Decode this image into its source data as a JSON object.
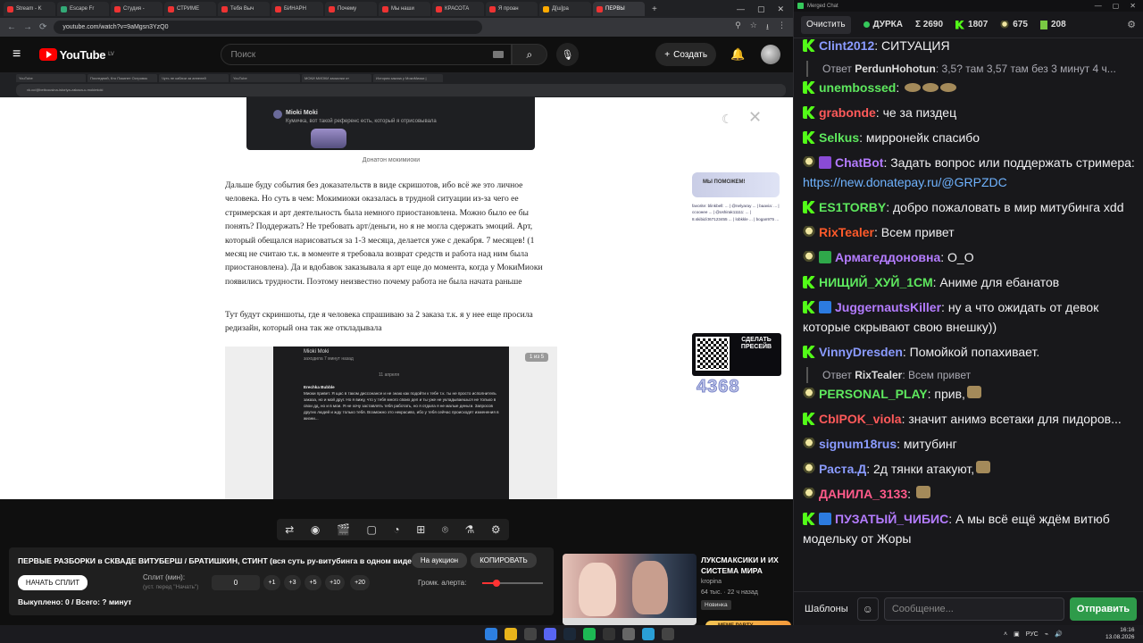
{
  "browser": {
    "tabs": [
      "Stream - K",
      "Escape Fr",
      "Студия -",
      "СТРИМЕ",
      "Тебя Выч",
      "БИНАРН",
      "Почему",
      "Мы наши",
      "КРАСОТА",
      "Я проан",
      "Д[ш]ра",
      "ПЕРВЫ"
    ],
    "url": "youtube.com/watch?v=9aMgsn3YzQ0"
  },
  "youtube": {
    "logo": "YouTube",
    "region": "LV",
    "search_placeholder": "Поиск",
    "create_label": "Создать"
  },
  "inner_browser": {
    "tabs": [
      "YouTube",
      "Последний, Кто Покинет Островок",
      "Чуть не кабачи за аппелей",
      "YouTube",
      "МОКИ МИОКИ заскалки от",
      "История заказа у МокиМиоки |"
    ],
    "url": "vk.cc/@bettcousina-istoriya-zakaza-u-mokimioki"
  },
  "article": {
    "image_user": "Mioki Moki",
    "image_subtitle": "Кумичка, вот такой референс есть, который я отрисовывала",
    "image_caption": "Донатон мокимиоки",
    "paragraph1": "Дальше буду события без доказательств в виде скришотов, ибо всё же это личное человека. Но суть в чем: Мокимиоки оказалась в трудной ситуации из-за чего ее стримерская и арт деятельность была немного приостановлена. Можно было ее бы понять? Поддержать? Не требовать арт/деньги, но я не могла сдержать эмоций. Арт, который обещался нарисоваться за 1-3 месяца, делается уже с декабря. 7 месяцев! (1 месяц не считаю т.к. в моменте я требовала возврат средств и работа над ним была приостановлена). Да и вдобавок заказывала я арт еще до момента, когда у МокиМиоки появились трудности. Поэтому неизвестно почему работа не была начата раньше",
    "paragraph2": "Тут будут скриншоты, где я человека спрашиваю за 2 заказа т.к. я у нее еще просила редизайн, который она так же откладывала",
    "screenshot_header": "Mioki Moki",
    "screenshot_sub": "заходила 7 минут назад",
    "screenshot_date": "11 апреля",
    "screenshot_sender": "Erechka Bubble",
    "screenshot_body": "Миоки привет. Я щас в таком диссонансе и не знаю как подойти к тебе т.к. ты не просто исполнитель заказа, но и мой друг. Но я вижу, что у тебя много своих дел и ты уже не укладываешься не только в свои дд, но и в мои. Я не хочу заставлять тебя работать, но я отдала я не малые деньги. Запросов других людей и жду только тебя. Возможно это некрасиво, ибо у тебя сейчас происходят изменения в жизни...",
    "screenshot_counter": "1 из 5",
    "ad_banner": "МЫ ПОМОЖЕМ!",
    "ad_list": "favorite: blinkbell: ... | @nelyaray ... | baavia: ... | ссоонее ... | @oshirak11111: ... | 8.skibidi:t67123455 ... | lobkkle ... | bogan975 ...",
    "qr_text": "СДЕЛАТЬ ПРЕСЕЙВ",
    "donation_number": "4368"
  },
  "stream_panel": {
    "title": "ПЕРВЫЕ РАЗБОРКИ в СКВАДЕ ВИТУБЕРШ / БРАТИШКИН, СТИНТ (вся суть ру-витубинга в одном видео)",
    "auction_label": "На аукцион",
    "copy_label": "КОПИРОВАТЬ",
    "start_label": "НАЧАТЬ СПЛИТ",
    "split_label": "Сплит (мин):",
    "split_hint": "(уст. перед \"Начать\")",
    "split_value": "0",
    "increments": [
      "+1",
      "+3",
      "+5",
      "+10",
      "+20"
    ],
    "alert_label": "Громк. алерта:",
    "alert_volume": 0.23,
    "footer": "Выкуплено: 0 / Всего: ? минут"
  },
  "recommendation": {
    "title": "ЛУКСМАКСИКИ И ИХ СИСТЕМА МИРА",
    "channel": "kropina",
    "stats": "64 тыс. · 22 ч назад",
    "badge": "Новинка"
  },
  "meme_party": "MEME PARTY",
  "taskbar": {
    "lang": "РУС",
    "time": "16:16",
    "date": "13.08.2026"
  },
  "chat": {
    "window_title": "Merged Chat",
    "clear_label": "Очистить",
    "stat_name": "ДУРКА",
    "stat_total": "Σ 2690",
    "stat_kick": "1807",
    "stat_pepe": "675",
    "stat_other": "208",
    "templates_label": "Шаблоны",
    "input_placeholder": "Сообщение...",
    "send_label": "Отправить",
    "messages": [
      {
        "badge": "k",
        "user": "Clint2012",
        "color": "#8a9bff",
        "text": "СИТУАЦИЯ"
      },
      {
        "reply": true,
        "reply_user": "PerdunHohotun",
        "reply_text": "3,5? там 3,57 там без 3 минут 4 ч..."
      },
      {
        "badge": "k",
        "user": "unembossed",
        "color": "#5ee85e",
        "text": ""
      },
      {
        "badge": "k",
        "user": "grabonde",
        "color": "#ff5a5a",
        "text": "че за пиздец"
      },
      {
        "badge": "k",
        "user": "Selkus",
        "color": "#5ee85e",
        "text": "мирронейк спасибо"
      },
      {
        "badge": "pepe",
        "user": "ChatBot",
        "color": "#b47cff",
        "text": "Задать вопрос или поддержать стримера: ",
        "link": "https://new.donatepay.ru/@GRPZDC"
      },
      {
        "badge": "k",
        "user": "ES1TORBY",
        "color": "#5ee85e",
        "text": "добро пожаловать в мир митубинга xdd"
      },
      {
        "badge": "pepe",
        "user": "RixTealer",
        "color": "#ff5a2a",
        "text": "Всем привет"
      },
      {
        "badge": "pepe",
        "user": "Армагеддоновна",
        "color": "#b47cff",
        "text": "О_О"
      },
      {
        "badge": "k",
        "user": "НИЩИЙ_ХУЙ_1СМ",
        "color": "#5ee85e",
        "text": "Аниме для ебанатов"
      },
      {
        "badge": "k",
        "user": "JuggernautsKiller",
        "color": "#b47cff",
        "text": "ну а что ожидать от девок которые скрывают свою внешку))"
      },
      {
        "badge": "k",
        "user": "VinnyDresden",
        "color": "#8a9bff",
        "text": "Помойкой попахивает."
      },
      {
        "reply": true,
        "reply_user": "RixTealer",
        "reply_text": "Всем привет"
      },
      {
        "badge": "pepe",
        "user": "PERSONAL_PLAY",
        "color": "#5ee85e",
        "text": "прив,"
      },
      {
        "badge": "k",
        "user": "CbIPOK_viola",
        "color": "#ff5a5a",
        "text": "значит анимэ всетаки для пидоров..."
      },
      {
        "badge": "pepe",
        "user": "signum18rus",
        "color": "#8a9bff",
        "text": "митубинг"
      },
      {
        "badge": "pepe",
        "user": "Раста.Д",
        "color": "#8a9bff",
        "text": "2д тянки атакуют,"
      },
      {
        "badge": "pepe",
        "user": "ДАНИЛА_3133",
        "color": "#ff5a8a",
        "text": ""
      },
      {
        "badge": "k",
        "user": "ПУЗАТЫЙ_ЧИБИС",
        "color": "#b47cff",
        "text": "А мы всё ещё ждём витюб модельку от Жоры"
      }
    ]
  }
}
